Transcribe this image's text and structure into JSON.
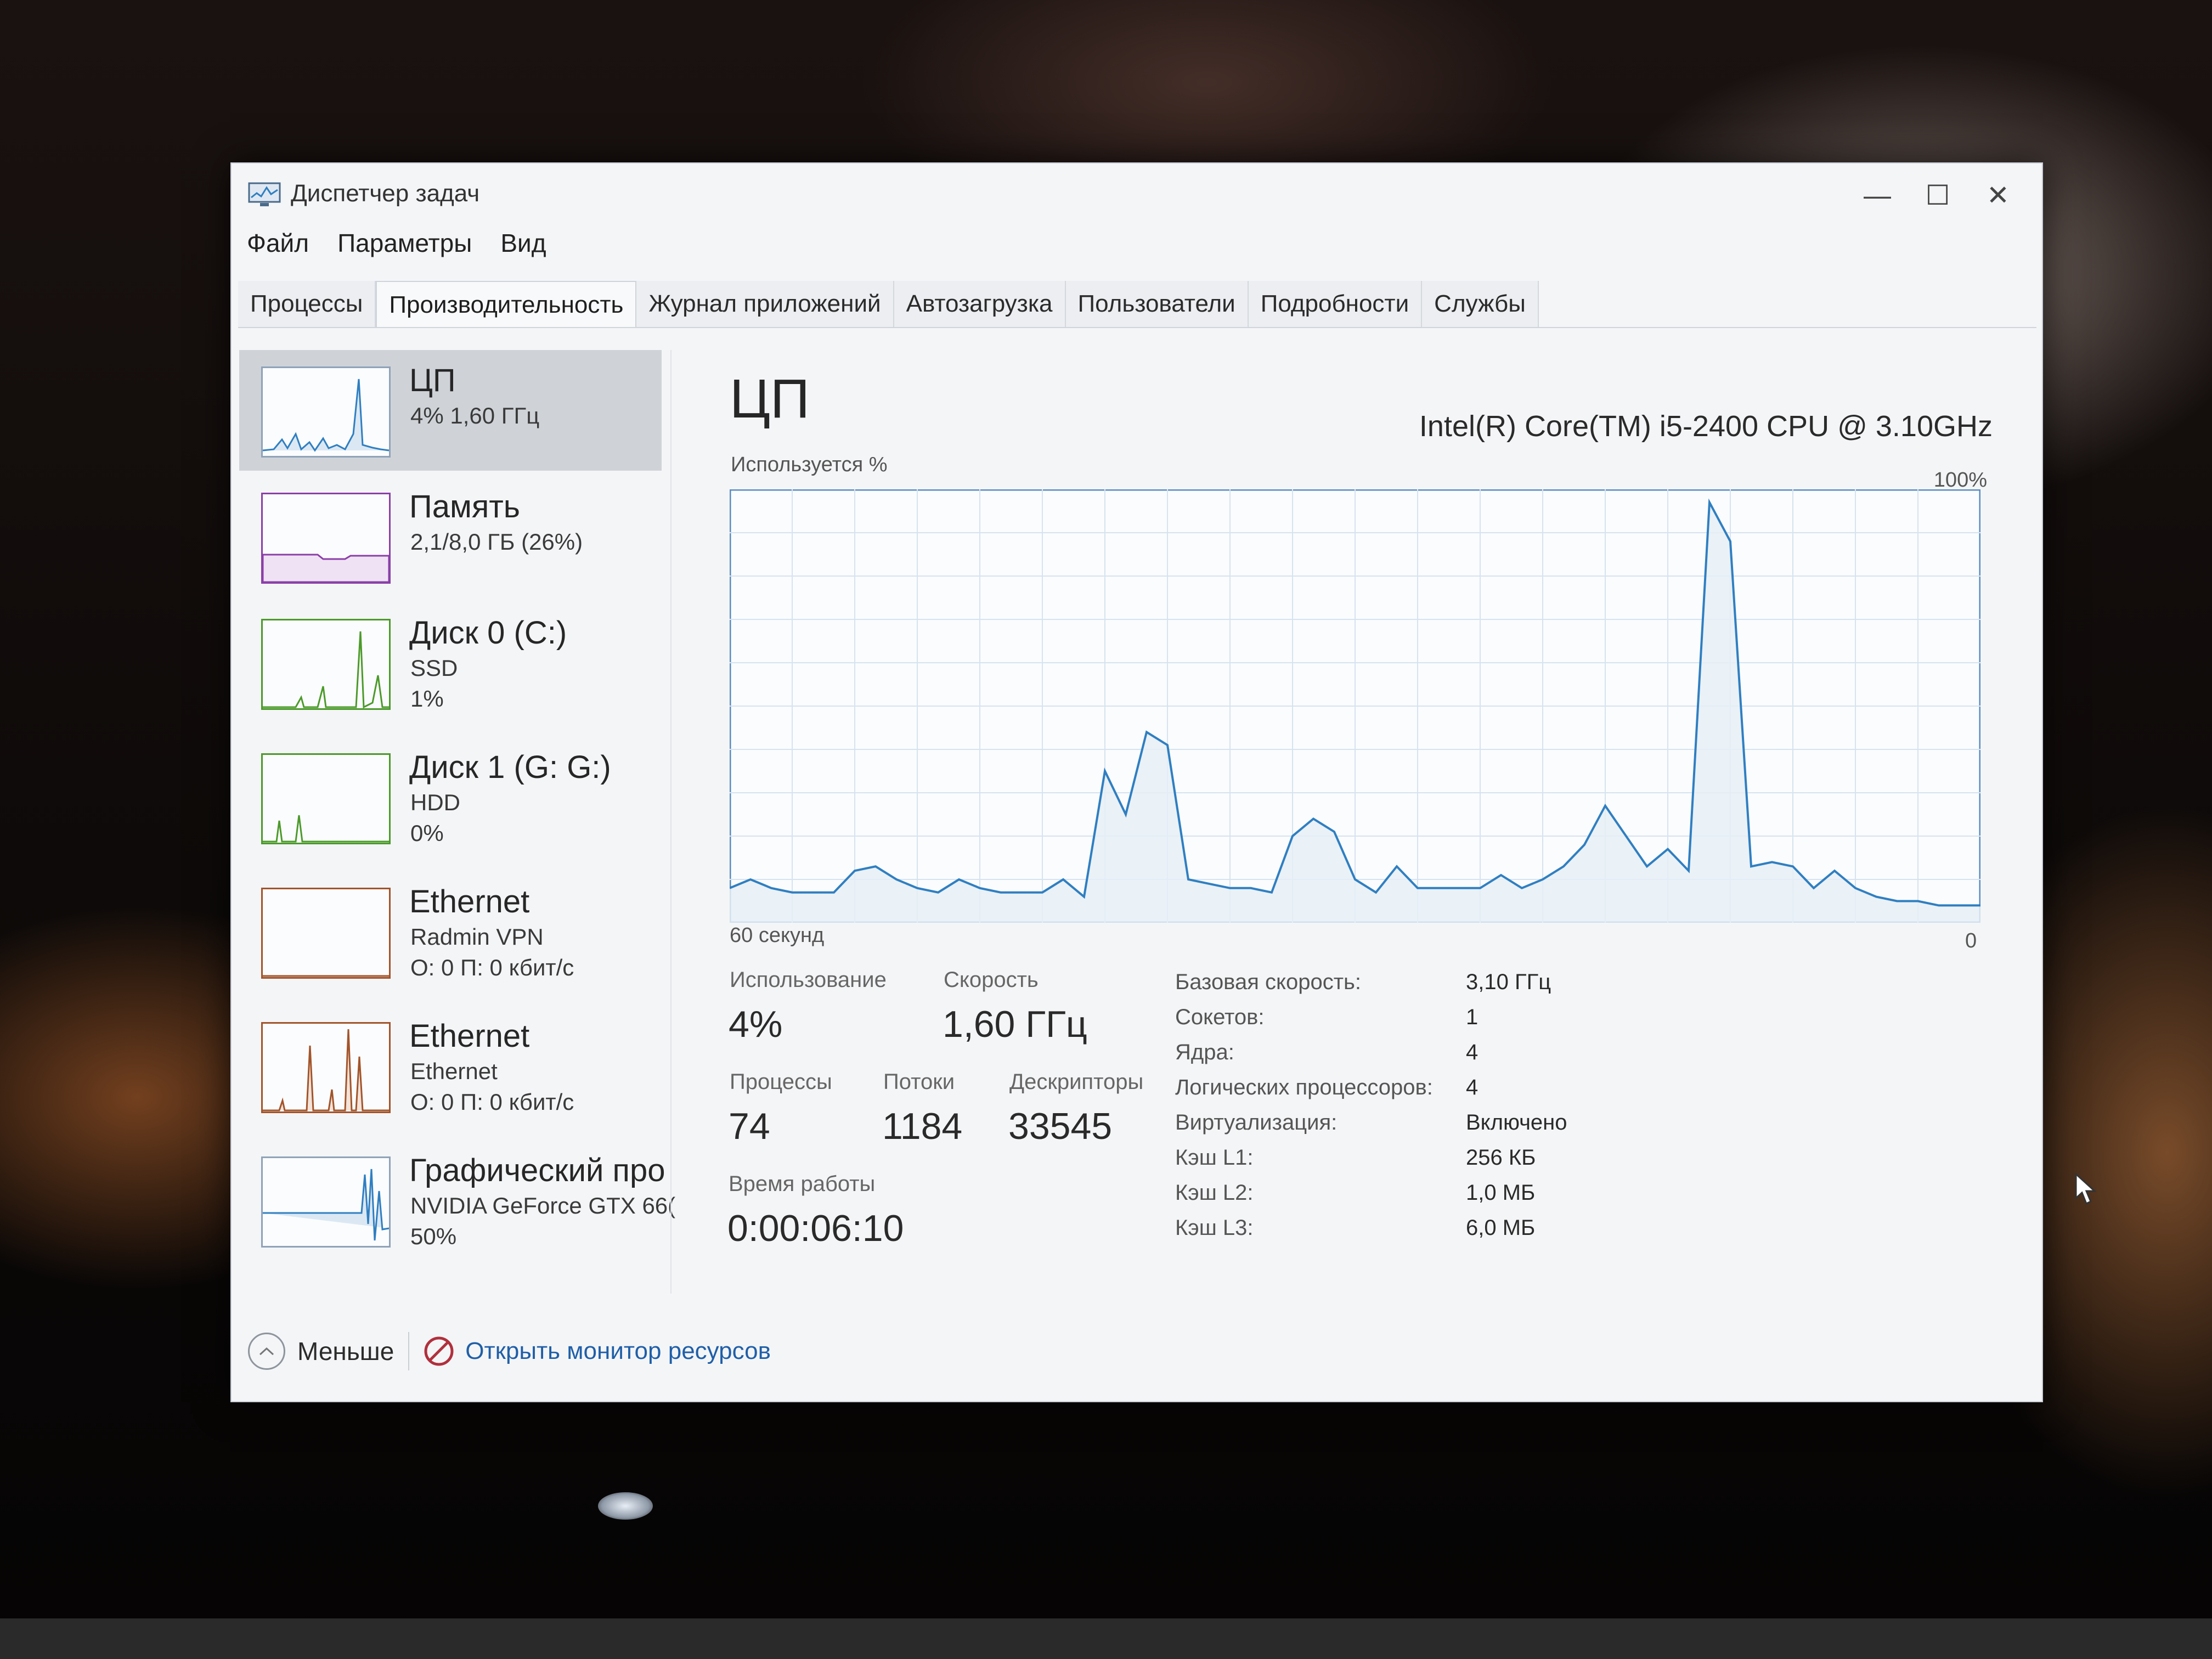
{
  "window": {
    "title": "Диспетчер задач",
    "controls": {
      "minimize": "—",
      "maximize": "☐",
      "close": "✕"
    }
  },
  "menu": {
    "file": "Файл",
    "options": "Параметры",
    "view": "Вид"
  },
  "tabs": [
    {
      "label": "Процессы"
    },
    {
      "label": "Производительность",
      "active": true
    },
    {
      "label": "Журнал приложений"
    },
    {
      "label": "Автозагрузка"
    },
    {
      "label": "Пользователи"
    },
    {
      "label": "Подробности"
    },
    {
      "label": "Службы"
    }
  ],
  "sidebar": {
    "items": [
      {
        "title": "ЦП",
        "line2": "4% 1,60 ГГц",
        "line3": "",
        "active": true,
        "color": "#2f7fc1"
      },
      {
        "title": "Память",
        "line2": "2,1/8,0 ГБ (26%)",
        "line3": "",
        "color": "#8b3fa8"
      },
      {
        "title": "Диск 0 (C:)",
        "line2": "SSD",
        "line3": "1%",
        "color": "#4b9a2a"
      },
      {
        "title": "Диск 1 (G: G:)",
        "line2": "HDD",
        "line3": "0%",
        "color": "#4b9a2a"
      },
      {
        "title": "Ethernet",
        "line2": "Radmin VPN",
        "line3": "О: 0 П: 0 кбит/с",
        "color": "#a2542a"
      },
      {
        "title": "Ethernet",
        "line2": "Ethernet",
        "line3": "О: 0 П: 0 кбит/с",
        "color": "#a2542a"
      },
      {
        "title": "Графический про",
        "line2": "NVIDIA GeForce GTX 66(",
        "line3": "50%",
        "color": "#2f7fc1"
      }
    ]
  },
  "main": {
    "title": "ЦП",
    "cpu_name": "Intel(R) Core(TM) i5-2400 CPU @ 3.10GHz",
    "chart_top_left": "Используется %",
    "chart_top_right": "100%",
    "chart_bottom_left": "60 секунд",
    "chart_bottom_right": "0"
  },
  "chart_data": {
    "type": "area",
    "ylabel": "Используется %",
    "ylim": [
      0,
      100
    ],
    "x_range_seconds": [
      60,
      0
    ],
    "grid": true,
    "values": [
      8,
      10,
      8,
      7,
      7,
      7,
      12,
      13,
      10,
      8,
      7,
      10,
      8,
      7,
      7,
      7,
      10,
      6,
      35,
      25,
      44,
      41,
      10,
      9,
      8,
      8,
      7,
      20,
      24,
      21,
      10,
      7,
      13,
      8,
      8,
      8,
      8,
      11,
      8,
      10,
      13,
      18,
      27,
      20,
      13,
      17,
      12,
      97,
      88,
      13,
      14,
      13,
      8,
      12,
      8,
      6,
      5,
      5,
      4,
      4,
      4
    ]
  },
  "stats": {
    "utilization": {
      "label": "Использование",
      "value": "4%"
    },
    "speed": {
      "label": "Скорость",
      "value": "1,60 ГГц"
    },
    "processes": {
      "label": "Процессы",
      "value": "74"
    },
    "threads": {
      "label": "Потоки",
      "value": "1184"
    },
    "handles": {
      "label": "Дескрипторы",
      "value": "33545"
    },
    "uptime": {
      "label": "Время работы",
      "value": "0:00:06:10"
    }
  },
  "info": [
    {
      "label": "Базовая скорость:",
      "value": "3,10 ГГц"
    },
    {
      "label": "Сокетов:",
      "value": "1"
    },
    {
      "label": "Ядра:",
      "value": "4"
    },
    {
      "label": "Логических процессоров:",
      "value": "4"
    },
    {
      "label": "Виртуализация:",
      "value": "Включено"
    },
    {
      "label": "Кэш L1:",
      "value": "256 КБ"
    },
    {
      "label": "Кэш L2:",
      "value": "1,0 МБ"
    },
    {
      "label": "Кэш L3:",
      "value": "6,0 МБ"
    }
  ],
  "footer": {
    "fewer": "Меньше",
    "resource_monitor": "Открыть монитор ресурсов"
  },
  "colors": {
    "accent": "#2f7fc1",
    "link": "#1f5fa8",
    "grid": "#d6e3ef",
    "chart_fill": "#e6eef6"
  }
}
